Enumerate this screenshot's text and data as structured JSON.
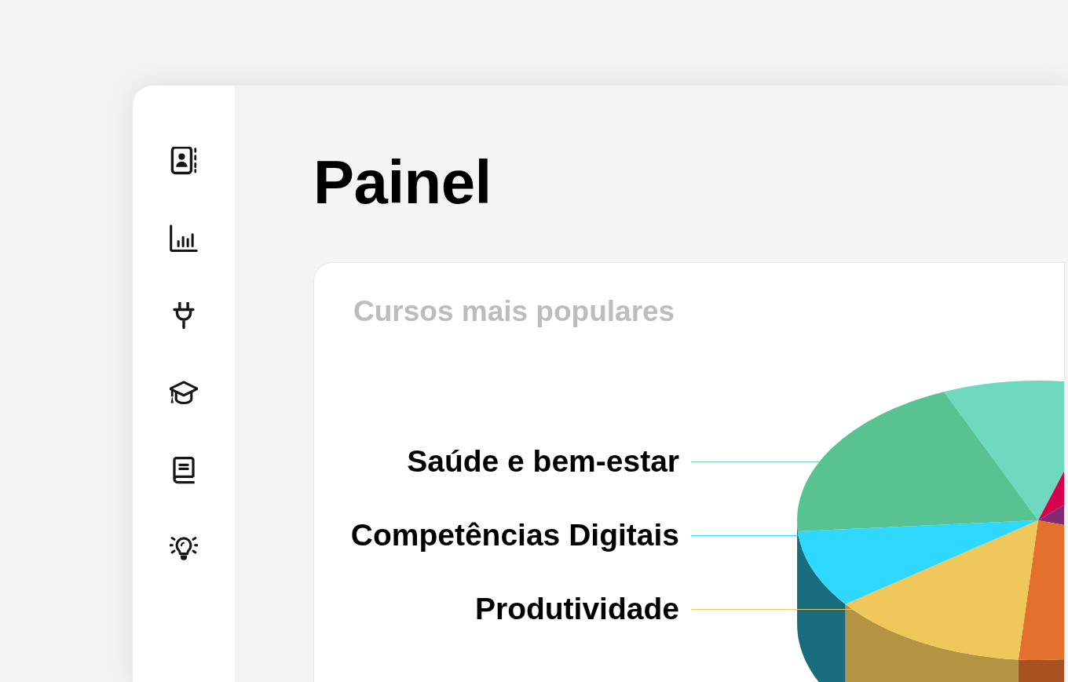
{
  "page": {
    "title": "Painel"
  },
  "popular_courses": {
    "title": "Cursos mais populares",
    "labels": [
      {
        "text": "Saúde e bem-estar",
        "color": "#6fd6bd"
      },
      {
        "text": "Competências Digitais",
        "color": "#2fd8ff"
      },
      {
        "text": "Produtividade",
        "color": "#f0c75a"
      }
    ]
  }
}
